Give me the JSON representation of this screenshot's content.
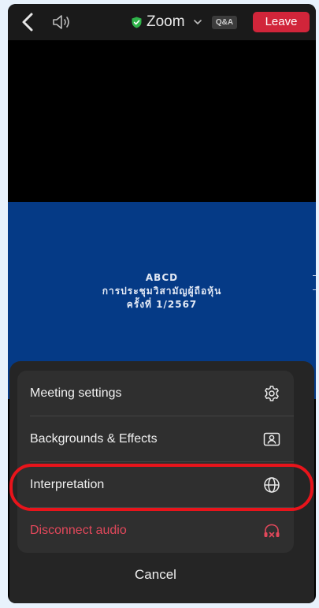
{
  "topbar": {
    "title": "Zoom",
    "qa_label": "Q&A",
    "leave_label": "Leave",
    "icons": [
      "back-arrow-icon",
      "speaker-icon",
      "shield-check-icon",
      "chevron-down-icon"
    ]
  },
  "shared_screen": {
    "line1": "ABCD",
    "line2": "การประชุมวิสามัญผู้ถือหุ้น",
    "line3": "ครั้งที่ 1/2567"
  },
  "menu": {
    "items": [
      {
        "label": "Meeting settings",
        "icon": "gear-icon"
      },
      {
        "label": "Backgrounds & Effects",
        "icon": "portrait-frame-icon"
      },
      {
        "label": "Interpretation",
        "icon": "globe-icon"
      },
      {
        "label": "Disconnect audio",
        "icon": "headphones-disconnect-icon"
      }
    ],
    "cancel_label": "Cancel"
  },
  "colors": {
    "leave": "#d1253a",
    "danger": "#e2485b",
    "share_bg": "#053a86",
    "highlight": "#e8141b"
  }
}
